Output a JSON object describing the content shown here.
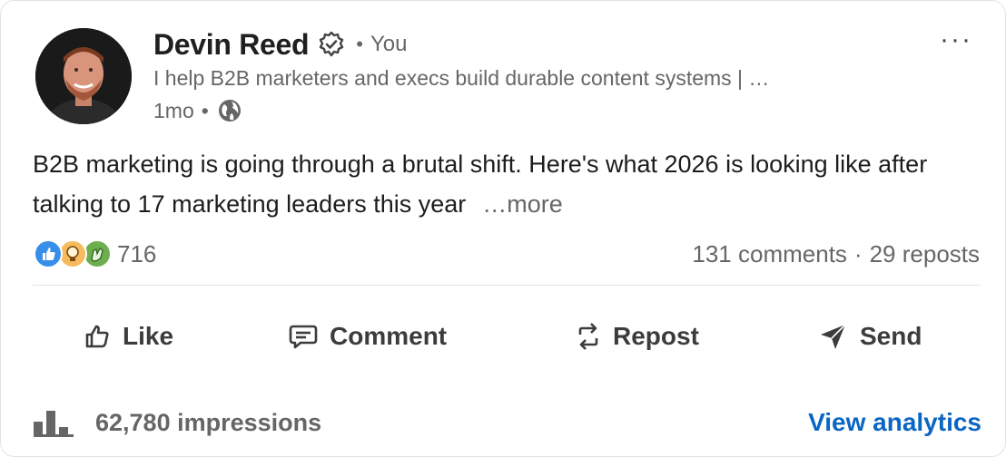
{
  "author": {
    "name": "Devin Reed",
    "relation_dot": "•",
    "relation": "You",
    "headline": "I help B2B marketers and execs build durable content systems | …",
    "time": "1mo",
    "time_dot": "•",
    "visibility_icon": "globe-icon",
    "verified_icon": "verified-badge-icon"
  },
  "menu": {
    "label": "···"
  },
  "post": {
    "text": "B2B marketing is going through a brutal shift. Here's what 2026 is looking like after talking to 17 marketing leaders this year",
    "more_label": "…more"
  },
  "social": {
    "reaction_icons": [
      "like-reaction-icon",
      "insightful-reaction-icon",
      "celebrate-reaction-icon"
    ],
    "reaction_count": "716",
    "comments": "131 comments",
    "sep": "·",
    "reposts": "29 reposts"
  },
  "actions": {
    "like": "Like",
    "comment": "Comment",
    "repost": "Repost",
    "send": "Send"
  },
  "footer": {
    "impressions": "62,780 impressions",
    "analytics_label": "View analytics"
  },
  "colors": {
    "link_blue": "#0a66c2",
    "muted_text": "#666666",
    "like_blue": "#378fe9",
    "insightful_yellow": "#f5bb5c",
    "celebrate_green": "#6dae4f"
  }
}
